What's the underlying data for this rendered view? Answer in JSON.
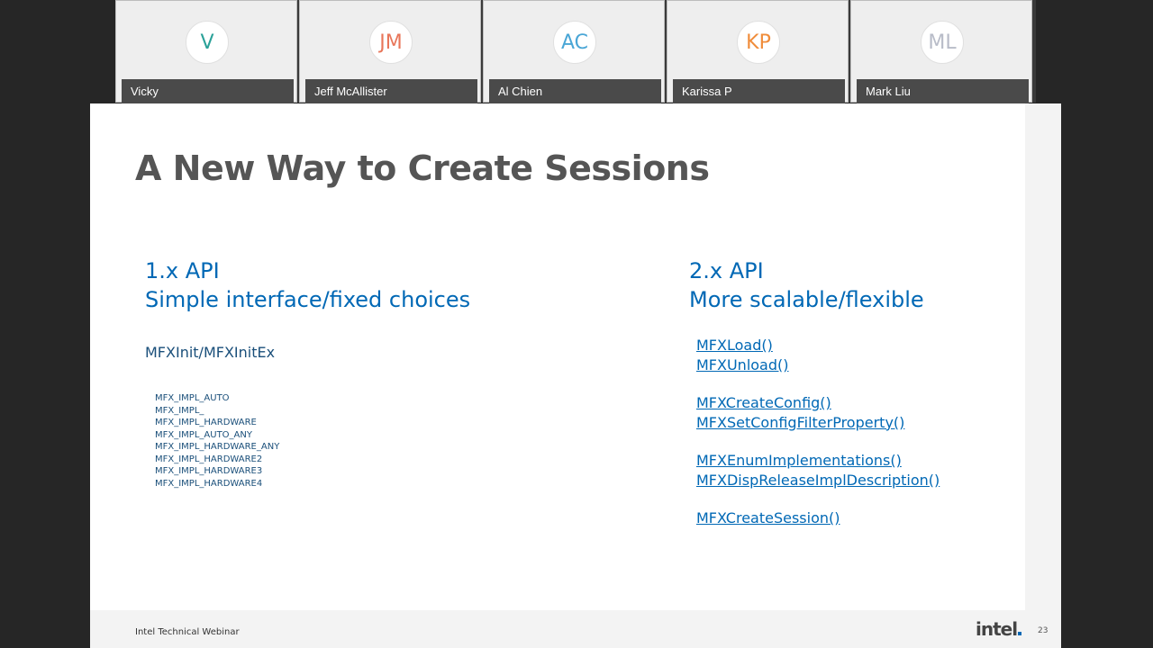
{
  "participants": [
    {
      "initials": "V",
      "name": "Vicky",
      "color": "#2aa198"
    },
    {
      "initials": "JM",
      "name": "Jeff McAllister",
      "color": "#e8765a"
    },
    {
      "initials": "AC",
      "name": "Al Chien",
      "color": "#4aa6d6"
    },
    {
      "initials": "KP",
      "name": "Karissa P",
      "color": "#f08c3a"
    },
    {
      "initials": "ML",
      "name": "Mark Liu",
      "color": "#b8bcc8"
    }
  ],
  "slide": {
    "title": "A New Way to Create Sessions",
    "left": {
      "heading_line1": "1.x API",
      "heading_line2": "Simple interface/fixed choices",
      "init_label": "MFXInit/MFXInitEx",
      "impl_items": [
        "MFX_IMPL_AUTO",
        "MFX_IMPL_",
        "MFX_IMPL_HARDWARE",
        "MFX_IMPL_AUTO_ANY",
        "MFX_IMPL_HARDWARE_ANY",
        "MFX_IMPL_HARDWARE2",
        "MFX_IMPL_HARDWARE3",
        "MFX_IMPL_HARDWARE4"
      ]
    },
    "right": {
      "heading_line1": "2.x API",
      "heading_line2": "More scalable/flexible",
      "function_groups": [
        [
          "MFXLoad()",
          "MFXUnload()"
        ],
        [
          "MFXCreateConfig()",
          "MFXSetConfigFilterProperty()"
        ],
        [
          "MFXEnumImplementations()",
          "MFXDispReleaseImplDescription()"
        ],
        [
          "MFXCreateSession()"
        ]
      ]
    },
    "footer_text": "Intel Technical Webinar",
    "logo_text": "intel",
    "page_number": "23"
  },
  "colors": {
    "accent_blue": "#0068b5",
    "title_gray": "#555555",
    "dark_bg": "#262626"
  }
}
